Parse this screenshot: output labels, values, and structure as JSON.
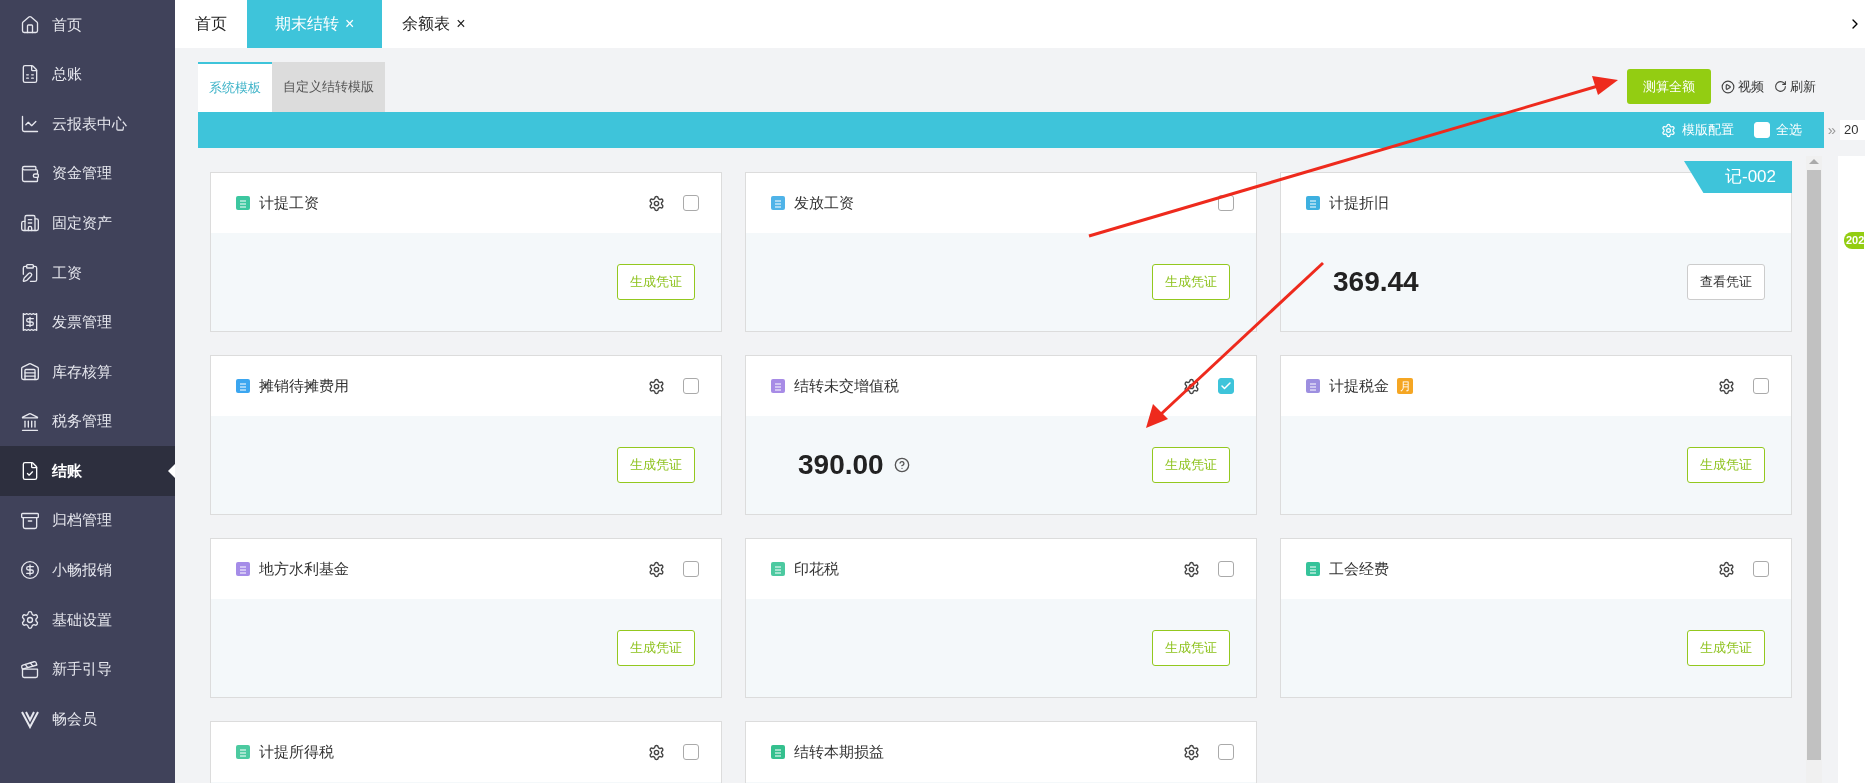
{
  "sidebar": {
    "items": [
      {
        "label": "首页",
        "selected": false
      },
      {
        "label": "总账",
        "selected": false
      },
      {
        "label": "云报表中心",
        "selected": false
      },
      {
        "label": "资金管理",
        "selected": false
      },
      {
        "label": "固定资产",
        "selected": false
      },
      {
        "label": "工资",
        "selected": false
      },
      {
        "label": "发票管理",
        "selected": false
      },
      {
        "label": "库存核算",
        "selected": false
      },
      {
        "label": "税务管理",
        "selected": false
      },
      {
        "label": "结账",
        "selected": true
      },
      {
        "label": "归档管理",
        "selected": false
      },
      {
        "label": "小畅报销",
        "selected": false
      },
      {
        "label": "基础设置",
        "selected": false
      },
      {
        "label": "新手引导",
        "selected": false
      },
      {
        "label": "畅会员",
        "selected": false
      }
    ]
  },
  "tabs": [
    {
      "label": "首页",
      "selected": false
    },
    {
      "label": "期末结转",
      "close": "×",
      "selected": true
    },
    {
      "label": "余额表",
      "close": "×",
      "selected": false
    }
  ],
  "template_tabs": [
    {
      "label": "系统模板",
      "selected": true
    },
    {
      "label": "自定义结转模版",
      "selected": false
    }
  ],
  "toolbar": {
    "calculate_button": "测算全额",
    "video": "视频",
    "refresh": "刷新"
  },
  "bar": {
    "config": "模版配置",
    "select_all": {
      "label": "全选",
      "checked": false
    }
  },
  "side_panel": {
    "expand": "»",
    "year": "20",
    "badge": "202"
  },
  "voucher_ribbon": "记-002",
  "cards": [
    {
      "title": "计提工资",
      "settings": true,
      "checked": false,
      "button": {
        "label": "生成凭证",
        "kind": "generate"
      }
    },
    {
      "title": "发放工资",
      "settings": false,
      "checked": false,
      "button": {
        "label": "生成凭证",
        "kind": "generate"
      }
    },
    {
      "title": "计提折旧",
      "amount": "369.44",
      "button": {
        "label": "查看凭证",
        "kind": "view"
      }
    },
    {
      "title": "摊销待摊费用",
      "settings": true,
      "checked": false,
      "button": {
        "label": "生成凭证",
        "kind": "generate"
      }
    },
    {
      "title": "结转未交增值税",
      "settings": true,
      "checked": true,
      "amount": "390.00",
      "help": true,
      "button": {
        "label": "生成凭证",
        "kind": "generate"
      }
    },
    {
      "title": "计提税金",
      "badge": "月",
      "settings": true,
      "checked": false,
      "button": {
        "label": "生成凭证",
        "kind": "generate"
      }
    },
    {
      "title": "地方水利基金",
      "settings": true,
      "checked": false,
      "button": {
        "label": "生成凭证",
        "kind": "generate"
      }
    },
    {
      "title": "印花税",
      "settings": true,
      "checked": false,
      "button": {
        "label": "生成凭证",
        "kind": "generate"
      }
    },
    {
      "title": "工会经费",
      "settings": true,
      "checked": false,
      "button": {
        "label": "生成凭证",
        "kind": "generate"
      }
    },
    {
      "title": "计提所得税",
      "settings": true,
      "checked": false
    },
    {
      "title": "结转本期损益",
      "settings": true,
      "checked": false
    }
  ]
}
